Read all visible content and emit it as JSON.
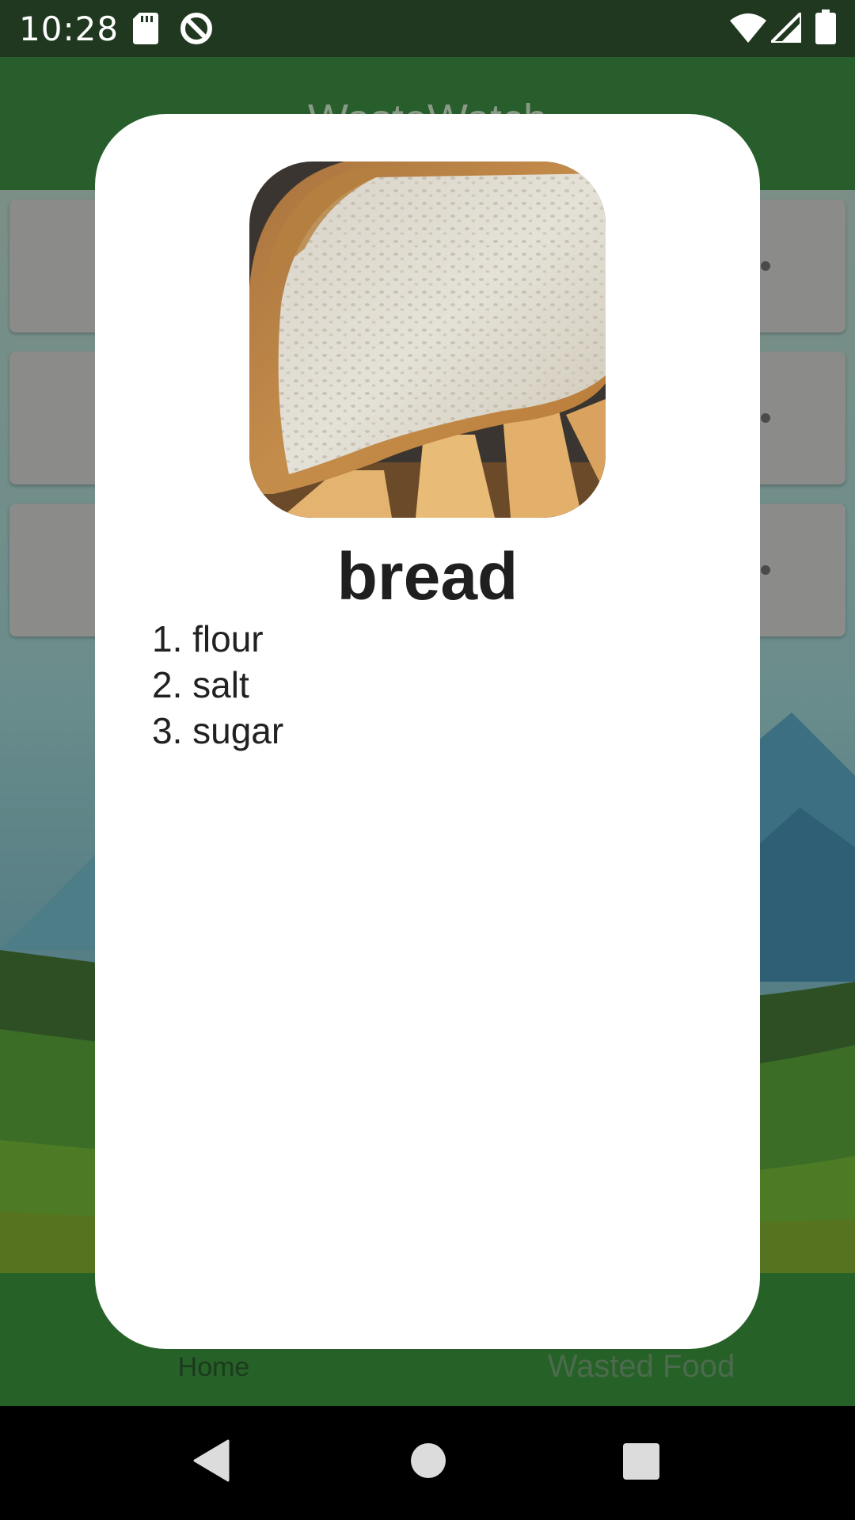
{
  "status_bar": {
    "time": "10:28",
    "left_icons": [
      "sd-card-icon",
      "no-disturb-icon"
    ],
    "right_icons": [
      "wifi-icon",
      "cell-signal-icon",
      "battery-icon"
    ]
  },
  "app": {
    "title": "WasteWatch",
    "background_cards": 3,
    "bottom_nav": {
      "home_label": "Home",
      "wasted_label": "Wasted Food"
    }
  },
  "dialog": {
    "image_icon": "bread-photo",
    "title": "bread",
    "ingredients": [
      "1. flour",
      "2. salt",
      "3. sugar"
    ]
  },
  "system_nav": [
    "back-icon",
    "home-icon",
    "recents-icon"
  ],
  "colors": {
    "status_bar": "#20381f",
    "app_bar": "#275e2c",
    "bottom_nav": "#266128",
    "dialog_bg": "#ffffff",
    "title_text": "#1f1f1f"
  }
}
